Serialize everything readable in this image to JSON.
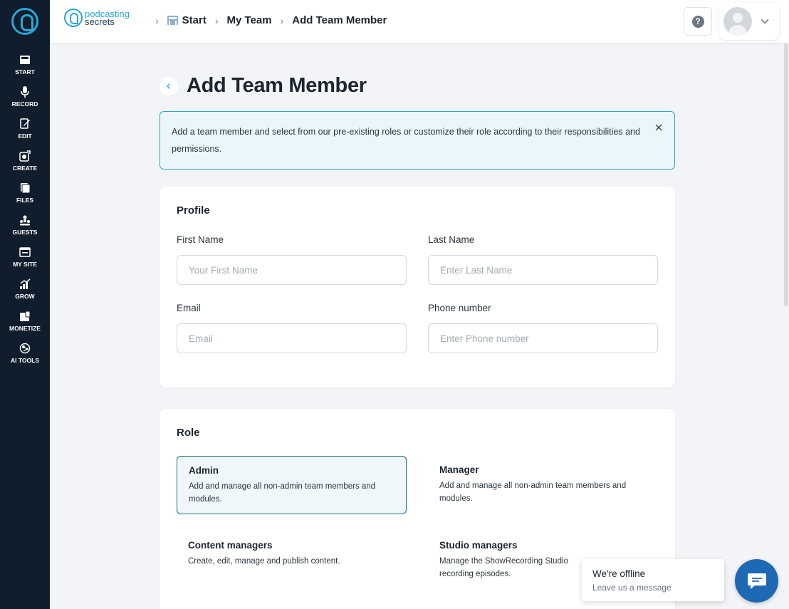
{
  "sidebar": {
    "items": [
      {
        "label": "START",
        "icon": "start-icon"
      },
      {
        "label": "RECORD",
        "icon": "microphone-icon"
      },
      {
        "label": "EDIT",
        "icon": "edit-icon"
      },
      {
        "label": "CREATE",
        "icon": "create-icon"
      },
      {
        "label": "FILES",
        "icon": "files-icon"
      },
      {
        "label": "GUESTS",
        "icon": "guests-icon"
      },
      {
        "label": "MY SITE",
        "icon": "my-site-icon"
      },
      {
        "label": "GROW",
        "icon": "grow-icon"
      },
      {
        "label": "MONETIZE",
        "icon": "monetize-icon"
      },
      {
        "label": "AI TOOLS",
        "icon": "ai-tools-icon"
      }
    ]
  },
  "header": {
    "brand_line1": "podcasting",
    "brand_line2": "secrets",
    "breadcrumbs": [
      "Start",
      "My Team",
      "Add Team Member"
    ],
    "help_label": "?"
  },
  "page": {
    "title": "Add Team Member",
    "notice": "Add a team member and select from our pre-existing roles or customize their role according to their responsibilities and permissions."
  },
  "profile": {
    "title": "Profile",
    "first_name": {
      "label": "First Name",
      "placeholder": "Your First Name",
      "value": ""
    },
    "last_name": {
      "label": "Last Name",
      "placeholder": "Enter Last Name",
      "value": ""
    },
    "email": {
      "label": "Email",
      "placeholder": "Email",
      "value": ""
    },
    "phone": {
      "label": "Phone number",
      "placeholder": "Enter Phone number",
      "value": ""
    }
  },
  "role": {
    "title": "Role",
    "selected": "Admin",
    "options": [
      {
        "name": "Admin",
        "desc": "Add and manage all non-admin team members and modules."
      },
      {
        "name": "Manager",
        "desc": "Add and manage all non-admin team members and modules."
      },
      {
        "name": "Content managers",
        "desc": "Create, edit, manage and publish content."
      },
      {
        "name": "Studio managers",
        "desc": "Manage the ShowRecording Studio recording episodes."
      }
    ]
  },
  "chat": {
    "title": "We're offline",
    "subtitle": "Leave us a message"
  },
  "colors": {
    "sidebar_bg": "#0f1d2c",
    "accent": "#2aa7d8",
    "chat_button": "#1d69b3",
    "selected_border": "#1e6b87"
  }
}
